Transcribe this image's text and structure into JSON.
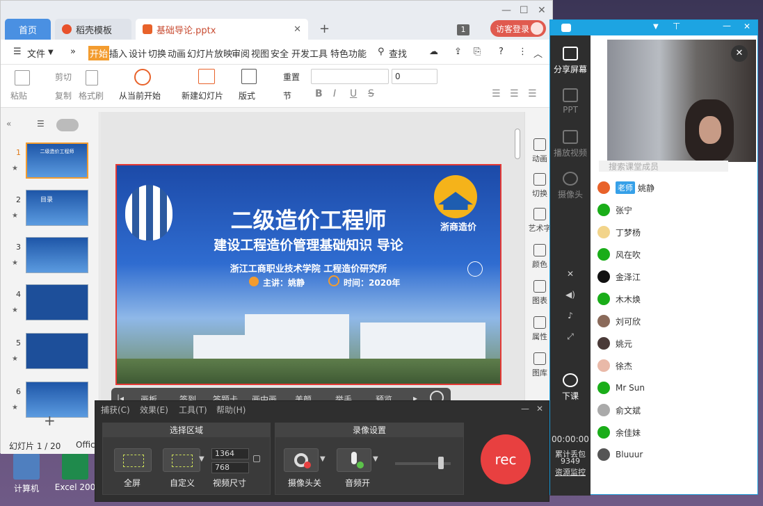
{
  "desktop": {
    "icons": [
      {
        "label": "计算机"
      },
      {
        "label": "Excel 200"
      }
    ]
  },
  "wps": {
    "tabs": {
      "home": "首页",
      "templates": "稻壳模板",
      "document": "基础导论.pptx"
    },
    "tab_count": "1",
    "login": "访客登录",
    "menu": {
      "file": "文件",
      "items": [
        "开始",
        "插入",
        "设计",
        "切换",
        "动画",
        "幻灯片放映",
        "审阅",
        "视图",
        "安全",
        "开发工具",
        "特色功能"
      ],
      "search": "查找"
    },
    "ribbon": {
      "paste": "粘贴",
      "cut": "剪切",
      "copy": "复制",
      "format_painter": "格式刷",
      "from_current": "从当前开始",
      "new_slide": "新建幻灯片",
      "layout": "版式",
      "section": "节",
      "reset": "重置",
      "font_size": "0"
    },
    "thumbnails": [
      {
        "num": "1",
        "text": "二级造价工程师"
      },
      {
        "num": "2",
        "text": "目录"
      },
      {
        "num": "3",
        "text": ""
      },
      {
        "num": "4",
        "text": ""
      },
      {
        "num": "5",
        "text": ""
      },
      {
        "num": "6",
        "text": ""
      }
    ],
    "status": {
      "slide_counter": "幻灯片 1 / 20",
      "office": "Offic"
    },
    "slide": {
      "title": "二级造价工程师",
      "subtitle": "建设工程造价管理基础知识  导论",
      "institute": "浙江工商职业技术学院    工程造价研究所",
      "lecturer": "主讲：姚静",
      "time": "时间：2020年",
      "logo": "浙商造价"
    },
    "right_panel": [
      "动画",
      "切换",
      "艺术字",
      "颜色",
      "图表",
      "属性",
      "图库"
    ]
  },
  "class_toolbar": [
    "画板",
    "签到",
    "答题卡",
    "画中画",
    "美颜",
    "举手",
    "预览"
  ],
  "recorder": {
    "menu": [
      "捕获(C)",
      "效果(E)",
      "工具(T)",
      "帮助(H)"
    ],
    "select_area": {
      "title": "选择区域",
      "fullscreen": "全屏",
      "custom": "自定义",
      "video_size": "视频尺寸",
      "width": "1364",
      "height": "768"
    },
    "record_settings": {
      "title": "录像设置",
      "camera": "摄像头关",
      "audio": "音频开"
    },
    "rec_label": "rec"
  },
  "classroom": {
    "sidebar": [
      {
        "label": "分享屏幕",
        "active": true
      },
      {
        "label": "PPT",
        "active": false
      },
      {
        "label": "播放视频",
        "active": false
      },
      {
        "label": "摄像头",
        "active": false
      }
    ],
    "end_class": "下课",
    "timer": "00:00:00",
    "packet_loss_label": "累计丢包",
    "packet_loss": "9349",
    "monitor": "资源监控",
    "search_placeholder": "搜索课堂成员",
    "teacher_tag": "老师",
    "members": [
      "姚静",
      "张宁",
      "丁梦杨",
      "风在吹",
      "金泽江",
      "木木焕",
      "刘可欣",
      "姚元",
      "徐杰",
      "Mr Sun",
      "俞文斌",
      "余佳妹",
      "Bluuur"
    ]
  }
}
